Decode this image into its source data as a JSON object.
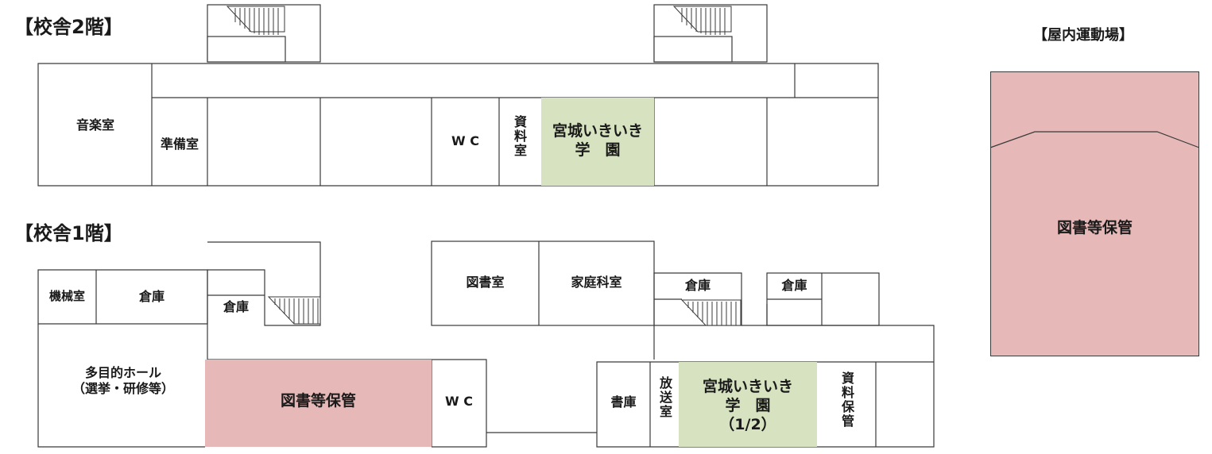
{
  "titles": {
    "floor2": "【校舎2階】",
    "floor1": "【校舎1階】",
    "gym": "【屋内運動場】"
  },
  "floor2": {
    "music": "音楽室",
    "prep": "準備室",
    "wc": "W C",
    "docs": "資料室",
    "miyagi": "宮城いきいき\n学　園"
  },
  "floor1": {
    "machine": "機械室",
    "storage_a": "倉庫",
    "storage_b": "倉庫",
    "library": "図書室",
    "homeec": "家庭科室",
    "storage_c": "倉庫",
    "storage_d": "倉庫",
    "hall": "多目的ホール\n（選挙・研修等）",
    "book_storage": "図書等保管",
    "wc": "W C",
    "archive": "書庫",
    "broadcast": "放送室",
    "miyagi": "宮城いきいき\n学　園\n（1/2）",
    "docs_storage": "資料保管"
  },
  "gym": {
    "book_storage": "図書等保管"
  },
  "colors": {
    "storage_highlight": "#e6b8b8",
    "miyagi_highlight": "#d7e3c0",
    "wall": "#3a3a3a"
  }
}
